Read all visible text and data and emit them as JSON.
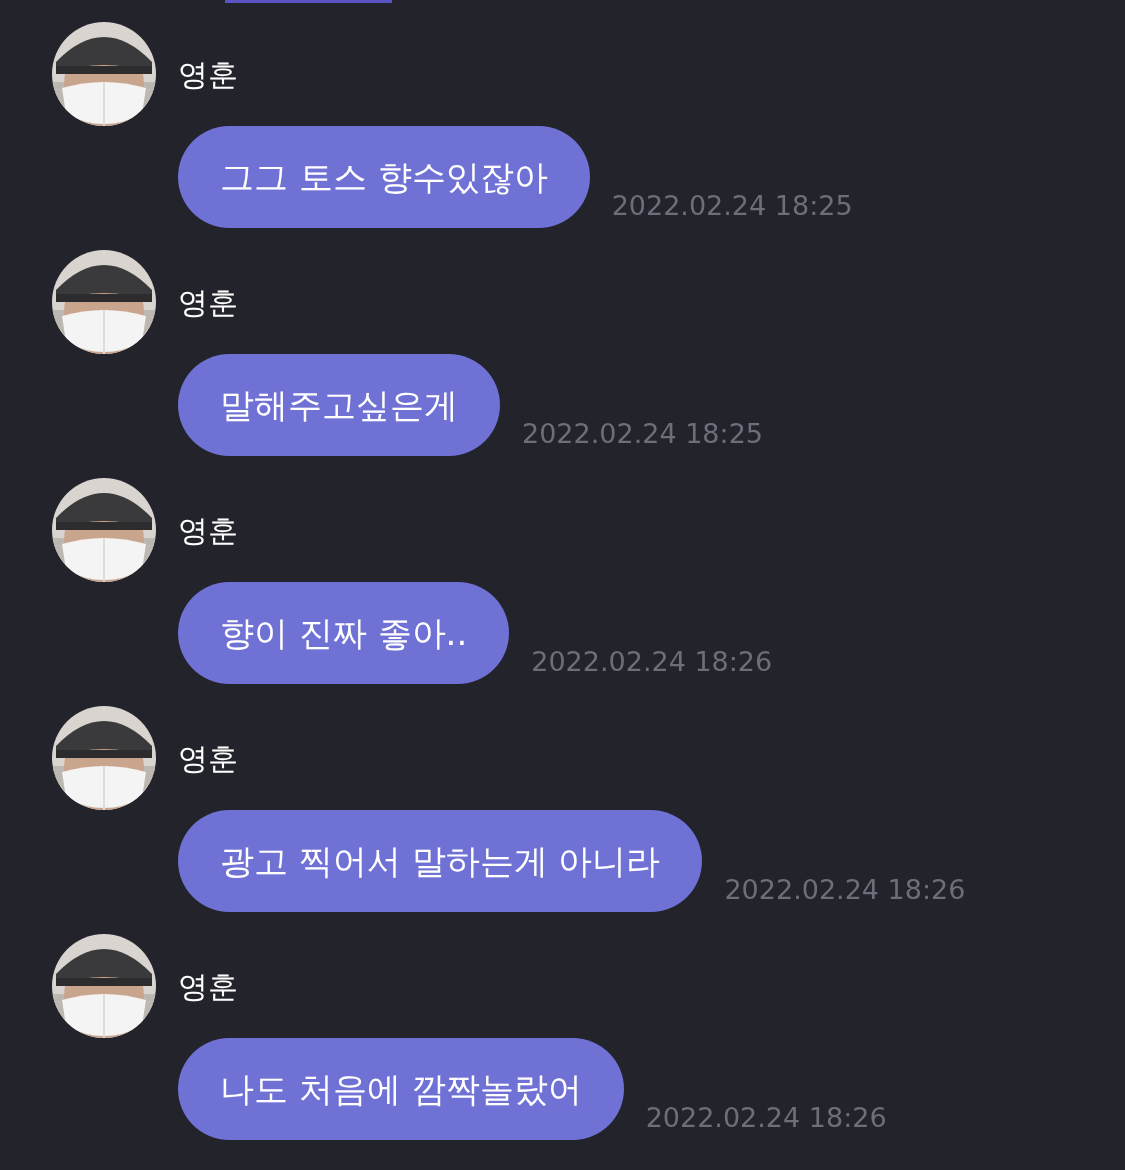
{
  "messages": [
    {
      "sender": "영훈",
      "text": "그그 토스 향수있잖아",
      "time": "2022.02.24 18:25"
    },
    {
      "sender": "영훈",
      "text": "말해주고싶은게",
      "time": "2022.02.24 18:25"
    },
    {
      "sender": "영훈",
      "text": "향이 진짜 좋아..",
      "time": "2022.02.24 18:26"
    },
    {
      "sender": "영훈",
      "text": "광고 찍어서 말하는게 아니라",
      "time": "2022.02.24 18:26"
    },
    {
      "sender": "영훈",
      "text": "나도 처음에 깜짝놀랐어",
      "time": "2022.02.24 18:26"
    }
  ]
}
